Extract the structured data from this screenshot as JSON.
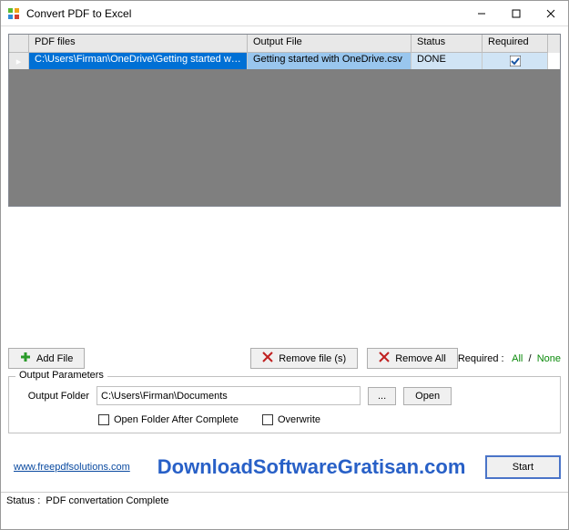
{
  "window": {
    "title": "Convert PDF to Excel"
  },
  "grid": {
    "headers": {
      "pdf": "PDF files",
      "output": "Output File",
      "status": "Status",
      "required": "Required"
    },
    "rows": [
      {
        "pdf": "C:\\Users\\Firman\\OneDrive\\Getting started with ...",
        "output": "Getting started with OneDrive.csv",
        "status": "DONE",
        "required_checked": true
      }
    ]
  },
  "toolbar": {
    "add_file": "Add File",
    "remove_file": "Remove file (s)",
    "remove_all": "Remove All",
    "required_label": "Required :",
    "required_all": "All",
    "required_sep": "/",
    "required_none": "None"
  },
  "output_params": {
    "group_title": "Output Parameters",
    "folder_label": "Output Folder",
    "folder_value": "C:\\Users\\Firman\\Documents",
    "browse": "...",
    "open": "Open",
    "open_after_label": "Open Folder After Complete",
    "overwrite_label": "Overwrite",
    "open_after_checked": false,
    "overwrite_checked": false
  },
  "footer": {
    "website": "www.freepdfsolutions.com",
    "watermark": "DownloadSoftwareGratisan.com",
    "start": "Start"
  },
  "statusbar": {
    "label": "Status :",
    "text": "PDF convertation Complete"
  }
}
